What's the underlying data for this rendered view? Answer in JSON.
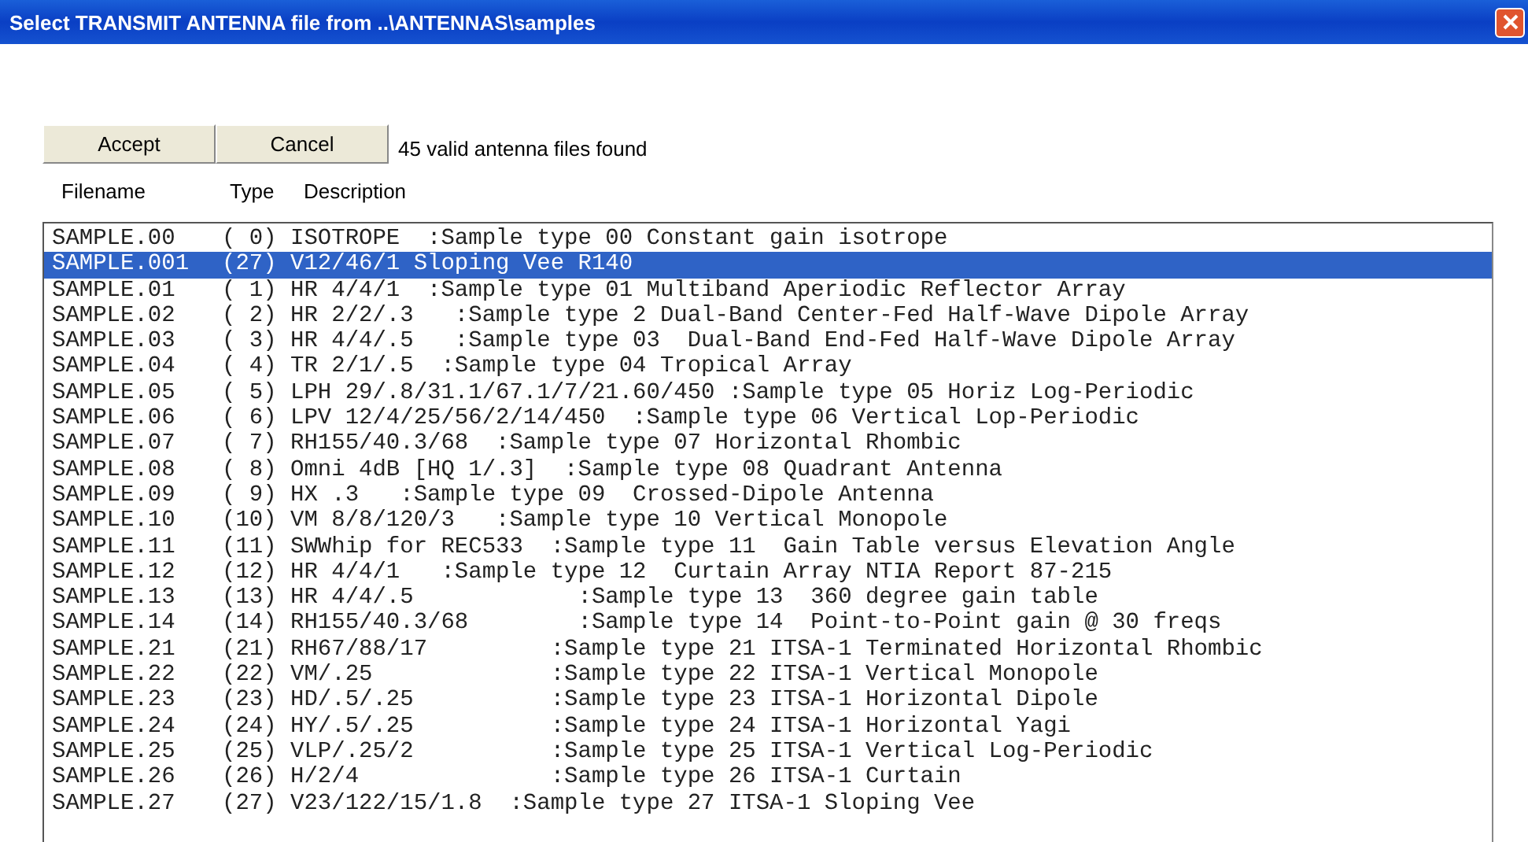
{
  "window": {
    "title": "Select TRANSMIT ANTENNA file from ..\\ANTENNAS\\samples"
  },
  "buttons": [
    "Accept",
    "Cancel"
  ],
  "status": "45 valid antenna files found",
  "columns": [
    "Filename",
    "Type",
    "Description"
  ],
  "rows": [
    {
      "filename": "SAMPLE.00",
      "entry": "( 0) ISOTROPE  :Sample type 00 Constant gain isotrope",
      "selected": false
    },
    {
      "filename": "SAMPLE.001",
      "entry": "(27) V12/46/1 Sloping Vee R140",
      "selected": true
    },
    {
      "filename": "SAMPLE.01",
      "entry": "( 1) HR 4/4/1  :Sample type 01 Multiband Aperiodic Reflector Array",
      "selected": false
    },
    {
      "filename": "SAMPLE.02",
      "entry": "( 2) HR 2/2/.3   :Sample type 2 Dual-Band Center-Fed Half-Wave Dipole Array",
      "selected": false
    },
    {
      "filename": "SAMPLE.03",
      "entry": "( 3) HR 4/4/.5   :Sample type 03  Dual-Band End-Fed Half-Wave Dipole Array",
      "selected": false
    },
    {
      "filename": "SAMPLE.04",
      "entry": "( 4) TR 2/1/.5  :Sample type 04 Tropical Array",
      "selected": false
    },
    {
      "filename": "SAMPLE.05",
      "entry": "( 5) LPH 29/.8/31.1/67.1/7/21.60/450 :Sample type 05 Horiz Log-Periodic",
      "selected": false
    },
    {
      "filename": "SAMPLE.06",
      "entry": "( 6) LPV 12/4/25/56/2/14/450  :Sample type 06 Vertical Lop-Periodic",
      "selected": false
    },
    {
      "filename": "SAMPLE.07",
      "entry": "( 7) RH155/40.3/68  :Sample type 07 Horizontal Rhombic",
      "selected": false
    },
    {
      "filename": "SAMPLE.08",
      "entry": "( 8) Omni 4dB [HQ 1/.3]  :Sample type 08 Quadrant Antenna",
      "selected": false
    },
    {
      "filename": "SAMPLE.09",
      "entry": "( 9) HX .3   :Sample type 09  Crossed-Dipole Antenna",
      "selected": false
    },
    {
      "filename": "SAMPLE.10",
      "entry": "(10) VM 8/8/120/3   :Sample type 10 Vertical Monopole",
      "selected": false
    },
    {
      "filename": "SAMPLE.11",
      "entry": "(11) SWWhip for REC533  :Sample type 11  Gain Table versus Elevation Angle",
      "selected": false
    },
    {
      "filename": "SAMPLE.12",
      "entry": "(12) HR 4/4/1   :Sample type 12  Curtain Array NTIA Report 87-215",
      "selected": false
    },
    {
      "filename": "SAMPLE.13",
      "entry": "(13) HR 4/4/.5            :Sample type 13  360 degree gain table",
      "selected": false
    },
    {
      "filename": "SAMPLE.14",
      "entry": "(14) RH155/40.3/68        :Sample type 14  Point-to-Point gain @ 30 freqs",
      "selected": false
    },
    {
      "filename": "SAMPLE.21",
      "entry": "(21) RH67/88/17         :Sample type 21 ITSA-1 Terminated Horizontal Rhombic",
      "selected": false
    },
    {
      "filename": "SAMPLE.22",
      "entry": "(22) VM/.25             :Sample type 22 ITSA-1 Vertical Monopole",
      "selected": false
    },
    {
      "filename": "SAMPLE.23",
      "entry": "(23) HD/.5/.25          :Sample type 23 ITSA-1 Horizontal Dipole",
      "selected": false
    },
    {
      "filename": "SAMPLE.24",
      "entry": "(24) HY/.5/.25          :Sample type 24 ITSA-1 Horizontal Yagi",
      "selected": false
    },
    {
      "filename": "SAMPLE.25",
      "entry": "(25) VLP/.25/2          :Sample type 25 ITSA-1 Vertical Log-Periodic",
      "selected": false
    },
    {
      "filename": "SAMPLE.26",
      "entry": "(26) H/2/4              :Sample type 26 ITSA-1 Curtain",
      "selected": false
    },
    {
      "filename": "SAMPLE.27",
      "entry": "(27) V23/122/15/1.8  :Sample type 27 ITSA-1 Sloping Vee",
      "selected": false
    }
  ]
}
